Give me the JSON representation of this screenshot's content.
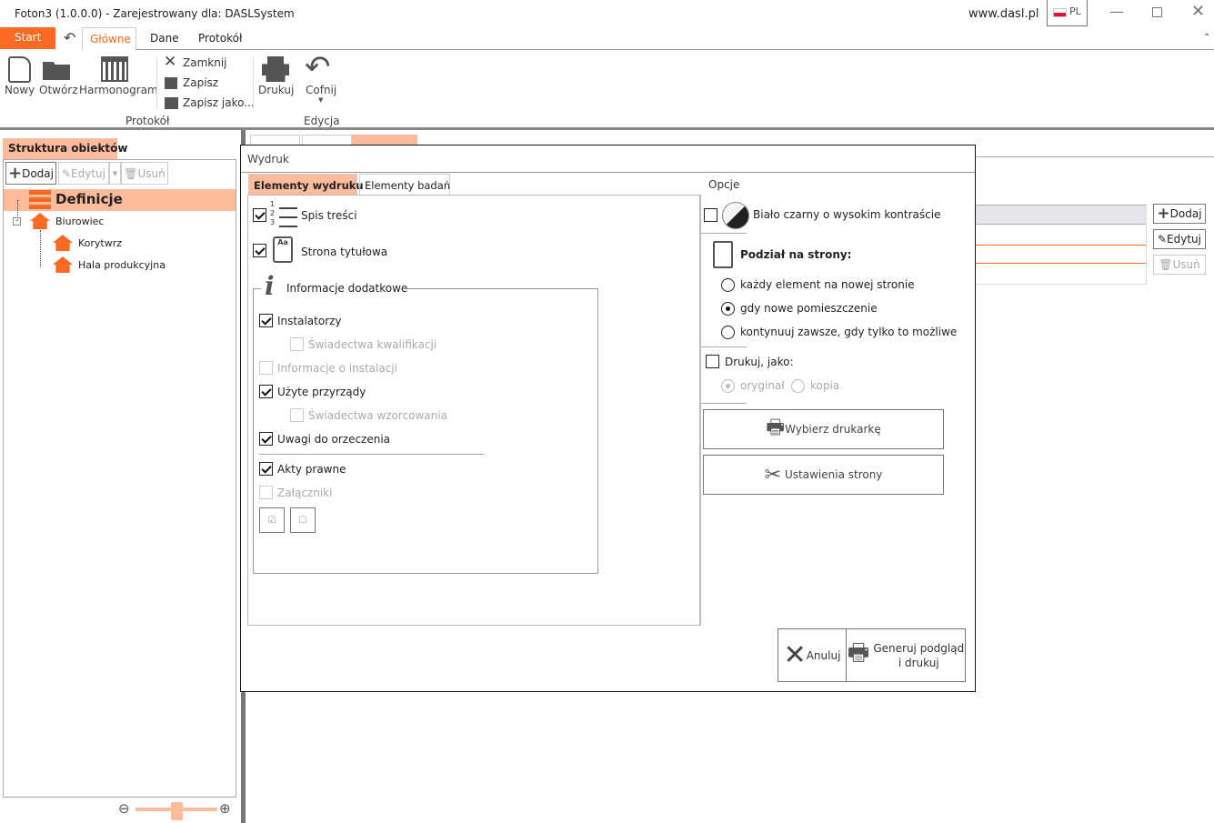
{
  "window": {
    "title": "Foton3 (1.0.0.0) - Zarejestrowany dla: DASLSystem",
    "website": "www.dasl.pl",
    "language": "PL"
  },
  "menu": {
    "start": "Start",
    "tabs": [
      "Główne",
      "Dane",
      "Protokół"
    ]
  },
  "ribbon": {
    "nowy": "Nowy",
    "otworz": "Otwórz",
    "harmonogram": "Harmonogram",
    "zamknij": "Zamknij",
    "zapisz": "Zapisz",
    "zapisz_jako": "Zapisz jako...",
    "drukuj": "Drukuj",
    "cofnij": "Cofnij",
    "group_protokol": "Protokół",
    "group_edycja": "Edycja"
  },
  "left_panel": {
    "tab": "Struktura obiektów",
    "add": "Dodaj",
    "edit": "Edytuj",
    "delete": "Usuń",
    "tree": {
      "root": "Definicje",
      "building": "Biurowiec",
      "children": [
        "Korytwrz",
        "Hala produkcyjna"
      ]
    },
    "zoom_level": 0.5
  },
  "background": {
    "add": "Dodaj",
    "edit": "Edytuj",
    "delete": "Usuń"
  },
  "dialog": {
    "title": "Wydruk",
    "tabs": [
      "Elementy wydruku",
      "Elementy badań"
    ],
    "items": {
      "toc": "Spis treści",
      "title_page": "Strona tytułowa",
      "group": "Informacje dodatkowe",
      "list": [
        {
          "label": "Instalatorzy",
          "checked": true,
          "enabled": true
        },
        {
          "label": "Świadectwa kwalifikacji",
          "checked": false,
          "enabled": false
        },
        {
          "label": "Informacje o instalacji",
          "checked": false,
          "enabled": false
        },
        {
          "label": "Użyte przyrządy",
          "checked": true,
          "enabled": true
        },
        {
          "label": "Świadectwa wzorcowania",
          "checked": false,
          "enabled": false
        },
        {
          "label": "Uwagi do orzeczenia",
          "checked": true,
          "enabled": true
        },
        {
          "label": "Akty prawne",
          "checked": true,
          "enabled": true
        },
        {
          "label": "Załączniki",
          "checked": false,
          "enabled": false
        }
      ]
    },
    "options": {
      "header": "Opcje",
      "bw": "Biało czarny o wysokim kontraście",
      "split_header": "Podział na strony:",
      "split": [
        "każdy element na nowej stronie",
        "gdy nowe pomieszczenie",
        "kontynuuj zawsze, gdy tylko to możliwe"
      ],
      "print_as": "Drukuj, jako:",
      "original": "oryginał",
      "copy": "kopia",
      "choose_printer": "Wybierz drukarkę",
      "page_setup": "Ustawienia strony"
    },
    "cancel": "Anuluj",
    "generate_1": "Generuj podgląd",
    "generate_2": "i drukuj"
  }
}
